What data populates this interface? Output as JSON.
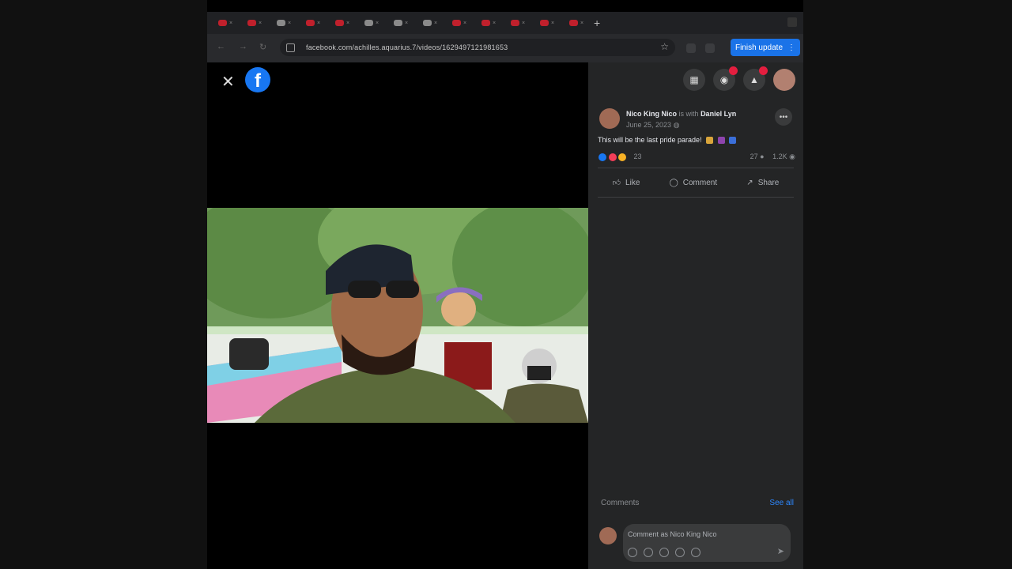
{
  "browser": {
    "tabs": [
      {
        "icon": "facebook-favicon",
        "color": "#c0202c"
      },
      {
        "icon": "facebook-favicon",
        "color": "#c0202c"
      },
      {
        "icon": "generic-favicon",
        "color": "#8a8a8a"
      },
      {
        "icon": "facebook-favicon",
        "color": "#c0202c"
      },
      {
        "icon": "facebook-favicon",
        "color": "#c0202c"
      },
      {
        "icon": "generic-favicon",
        "color": "#8a8a8a"
      },
      {
        "icon": "generic-favicon",
        "color": "#8a8a8a"
      },
      {
        "icon": "generic-favicon",
        "color": "#8a8a8a"
      },
      {
        "icon": "facebook-favicon",
        "color": "#c0202c"
      },
      {
        "icon": "facebook-favicon",
        "color": "#c0202c"
      },
      {
        "icon": "facebook-favicon",
        "color": "#c0202c"
      },
      {
        "icon": "facebook-favicon",
        "color": "#c0202c"
      },
      {
        "icon": "facebook-favicon",
        "color": "#c0202c"
      }
    ],
    "new_tab_label": "+",
    "url": "facebook.com/achilles.aquarius.7/videos/1629497121981653",
    "finish_update_label": "Finish update"
  },
  "viewer": {
    "close_label": "✕",
    "logo_letter": "f"
  },
  "post": {
    "author": "Nico King Nico",
    "with_text": "is with",
    "tagged": "Daniel Lyn",
    "date": "June 25, 2023",
    "caption": "This will be the last pride parade!",
    "reaction_count": "23",
    "comment_count": "27",
    "views": "1.2K"
  },
  "actions": {
    "like": "Like",
    "comment": "Comment",
    "share": "Share"
  },
  "comments": {
    "header": "Comments",
    "see_all": "See all",
    "placeholder": "Comment as Nico King Nico"
  },
  "colors": {
    "accent": "#1877f2",
    "panel_bg": "#242526",
    "badge": "#e41e3f"
  },
  "topbar": {
    "messenger_badge": "",
    "notifications_badge": ""
  }
}
